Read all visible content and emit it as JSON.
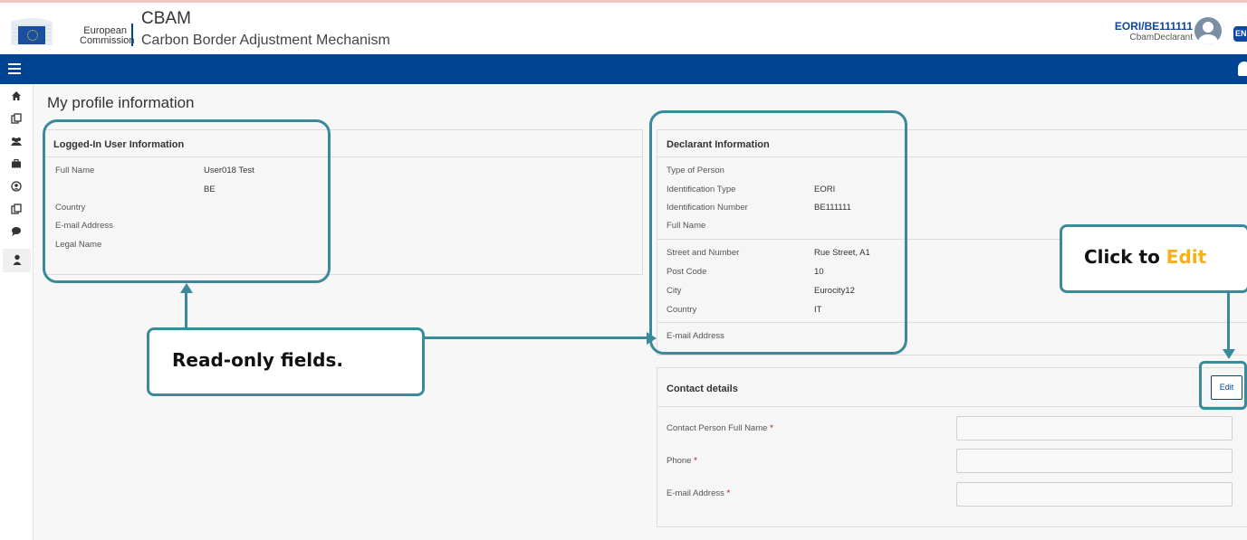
{
  "header": {
    "org_line1": "European",
    "org_line2": "Commission",
    "app_title": "CBAM",
    "app_subtitle": "Carbon Border Adjustment Mechanism",
    "user_id": "EORI/BE111111",
    "user_role": "CbamDeclarant",
    "language": "EN"
  },
  "main": {
    "page_title": "My profile information"
  },
  "logged_in": {
    "title": "Logged-In User Information",
    "rows": [
      {
        "label": "Full Name",
        "value": "User018 Test"
      },
      {
        "label": "",
        "value": "BE"
      },
      {
        "label": "Country",
        "value": ""
      },
      {
        "label": "E-mail Address",
        "value": ""
      },
      {
        "label": "Legal Name",
        "value": ""
      }
    ]
  },
  "declarant": {
    "title": "Declarant Information",
    "rows": [
      {
        "label": "Type of Person",
        "value": ""
      },
      {
        "label": "Identification Type",
        "value": "EORI"
      },
      {
        "label": "Identification Number",
        "value": "BE111111"
      },
      {
        "label": "Full Name",
        "value": ""
      }
    ],
    "address_rows": [
      {
        "label": "Street and Number",
        "value": "Rue Street, A1"
      },
      {
        "label": "Post Code",
        "value": "10"
      },
      {
        "label": "City",
        "value": "Eurocity12"
      },
      {
        "label": "Country",
        "value": "IT"
      }
    ],
    "email_label": "E-mail Address"
  },
  "contact": {
    "title": "Contact details",
    "edit_label": "Edit",
    "fields": [
      {
        "label": "Contact Person Full Name",
        "required": "*",
        "value": ""
      },
      {
        "label": "Phone",
        "required": "*",
        "value": ""
      },
      {
        "label": "E-mail Address",
        "required": "*",
        "value": ""
      }
    ]
  },
  "annotations": {
    "readonly_text": "Read-only fields.",
    "edit_text_prefix": "Click to ",
    "edit_text_highlight": "Edit",
    "accent_color": "#3a8a9c",
    "highlight_color": "#f5b01a"
  }
}
